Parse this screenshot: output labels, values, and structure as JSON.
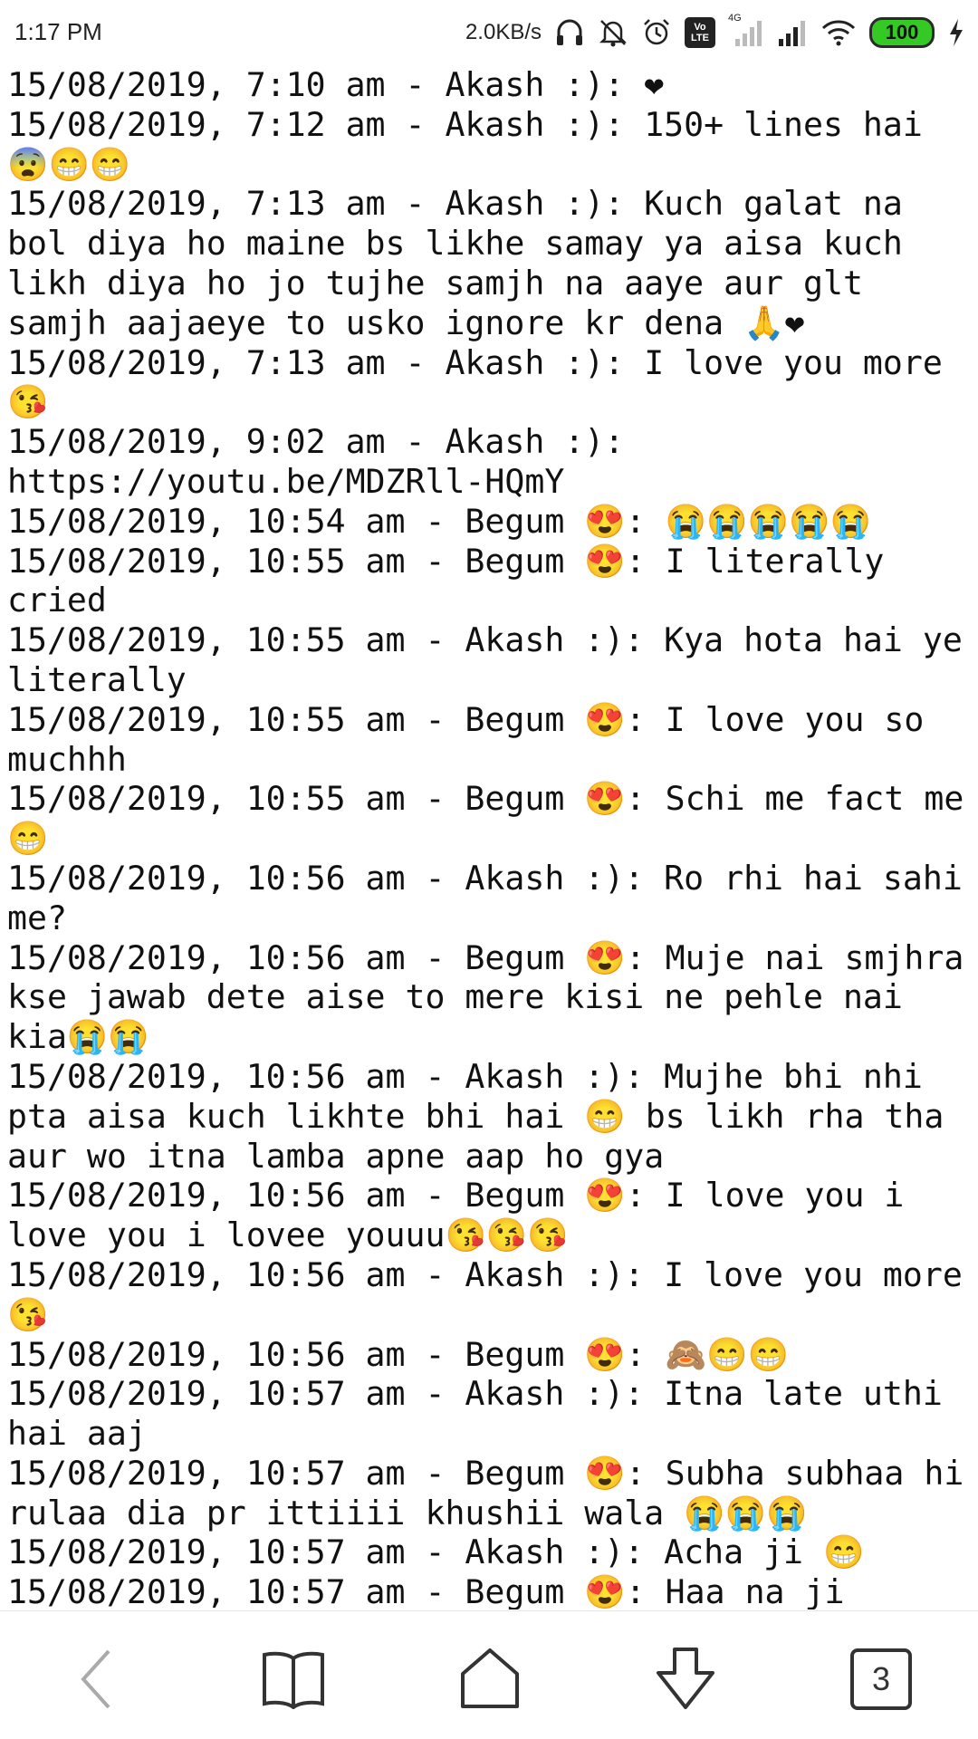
{
  "status_bar": {
    "time": "1:17 PM",
    "network_speed": "2.0KB/s",
    "battery_level": "100",
    "volte_label_top": "Vo",
    "volte_label_bottom": "LTE",
    "network_type": "4G",
    "icons": [
      "headphones-icon",
      "muted-bell-icon",
      "alarm-icon",
      "volte-icon",
      "signal-icon",
      "signal-icon",
      "wifi-icon",
      "battery-icon",
      "charging-icon"
    ],
    "battery_color": "#34c924"
  },
  "messages": [
    "15/08/2019, 7:10 am - Akash :): ❤",
    "15/08/2019, 7:12 am - Akash :): 150+ lines hai 😨😁😁",
    "15/08/2019, 7:13 am - Akash :): Kuch galat na bol diya ho maine bs likhe samay ya aisa kuch likh diya ho jo tujhe samjh na aaye aur glt samjh aajaeye to usko ignore kr dena 🙏❤",
    "15/08/2019, 7:13 am - Akash :): I love you more 😘",
    "15/08/2019, 9:02 am - Akash :): https://youtu.be/MDZRll-HQmY",
    "15/08/2019, 10:54 am - Begum 😍: 😭😭😭😭😭",
    "15/08/2019, 10:55 am - Begum 😍: I literally cried",
    "15/08/2019, 10:55 am - Akash :): Kya hota hai ye literally",
    "15/08/2019, 10:55 am - Begum 😍: I love you so muchhh",
    "15/08/2019, 10:55 am - Begum 😍: Schi me fact me😁",
    "15/08/2019, 10:56 am - Akash :): Ro rhi hai sahi me?",
    "15/08/2019, 10:56 am - Begum 😍: Muje nai smjhra kse jawab dete aise to mere kisi ne pehle nai kia😭😭",
    "15/08/2019, 10:56 am - Akash :): Mujhe bhi nhi pta aisa kuch likhte bhi hai 😁 bs likh rha tha aur wo itna lamba apne aap ho gya",
    "15/08/2019, 10:56 am - Begum 😍: I love you i love you i lovee youuu😘😘😘",
    "15/08/2019, 10:56 am - Akash :): I love you more 😘",
    "15/08/2019, 10:56 am - Begum 😍: 🙈😁😁",
    "15/08/2019, 10:57 am - Akash :): Itna late uthi hai aaj",
    "15/08/2019, 10:57 am - Begum 😍: Subha subhaa hi rulaa dia pr ittiiii khushii wala 😭😭😭",
    "15/08/2019, 10:57 am - Akash :): Acha ji 😁",
    "15/08/2019, 10:57 am - Begum 😍: Haa na ji"
  ],
  "bottom_nav": {
    "tab_count": "3",
    "icons": [
      "back-icon",
      "bookmarks-icon",
      "home-icon",
      "download-icon",
      "tabs-icon"
    ]
  }
}
